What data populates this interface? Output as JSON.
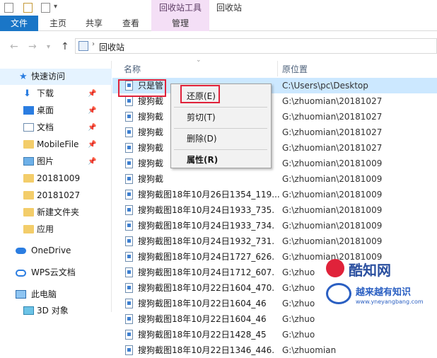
{
  "window": {
    "title": "回收站",
    "tools_label": "回收站工具"
  },
  "ribbon": {
    "tabs": [
      "文件",
      "主页",
      "共享",
      "查看",
      "管理"
    ]
  },
  "address": {
    "path": "回收站"
  },
  "sidebar": {
    "items": [
      {
        "label": "快速访问",
        "icon": "star-icon",
        "pinned": false
      },
      {
        "label": "下载",
        "icon": "download-icon",
        "pinned": true
      },
      {
        "label": "桌面",
        "icon": "desktop-icon",
        "pinned": true
      },
      {
        "label": "文档",
        "icon": "document-icon",
        "pinned": true
      },
      {
        "label": "MobileFile",
        "icon": "folder-icon",
        "pinned": true
      },
      {
        "label": "图片",
        "icon": "pictures-icon",
        "pinned": true
      },
      {
        "label": "20181009",
        "icon": "folder-icon",
        "pinned": false
      },
      {
        "label": "20181027",
        "icon": "folder-icon",
        "pinned": false
      },
      {
        "label": "新建文件夹",
        "icon": "folder-icon",
        "pinned": false
      },
      {
        "label": "应用",
        "icon": "folder-icon",
        "pinned": false
      },
      {
        "label": "OneDrive",
        "icon": "cloud-icon",
        "pinned": false
      },
      {
        "label": "WPS云文档",
        "icon": "wps-cloud-icon",
        "pinned": false
      },
      {
        "label": "此电脑",
        "icon": "computer-icon",
        "pinned": false
      },
      {
        "label": "3D 对象",
        "icon": "3d-objects-icon",
        "pinned": false
      }
    ]
  },
  "list": {
    "columns": [
      "名称",
      "原位置"
    ],
    "rows": [
      {
        "name": "只是管",
        "path": "C:\\Users\\pc\\Desktop",
        "selected": true
      },
      {
        "name": "搜狗截",
        "path": "G:\\zhuomian\\20181027"
      },
      {
        "name": "搜狗截",
        "path": "G:\\zhuomian\\20181027"
      },
      {
        "name": "搜狗截",
        "path": "G:\\zhuomian\\20181027"
      },
      {
        "name": "搜狗截",
        "path": "G:\\zhuomian\\20181027"
      },
      {
        "name": "搜狗截",
        "path": "G:\\zhuomian\\20181009"
      },
      {
        "name": "搜狗截",
        "path": "G:\\zhuomian\\20181009"
      },
      {
        "name": "搜狗截图18年10月26日1354_119...",
        "path": "G:\\zhuomian\\20181009"
      },
      {
        "name": "搜狗截图18年10月24日1933_735.",
        "path": "G:\\zhuomian\\20181009"
      },
      {
        "name": "搜狗截图18年10月24日1933_734.",
        "path": "G:\\zhuomian\\20181009"
      },
      {
        "name": "搜狗截图18年10月24日1932_731.",
        "path": "G:\\zhuomian\\20181009"
      },
      {
        "name": "搜狗截图18年10月24日1727_626.",
        "path": "G:\\zhuomian\\20181009"
      },
      {
        "name": "搜狗截图18年10月24日1712_607.",
        "path": "G:\\zhuo"
      },
      {
        "name": "搜狗截图18年10月22日1604_470.",
        "path": "G:\\zhuo"
      },
      {
        "name": "搜狗截图18年10月22日1604_46",
        "path": "G:\\zhuo"
      },
      {
        "name": "搜狗截图18年10月22日1604_46",
        "path": "G:\\zhuo"
      },
      {
        "name": "搜狗截图18年10月22日1428_45",
        "path": "G:\\zhuo"
      },
      {
        "name": "搜狗截图18年10月22日1346_446.",
        "path": "G:\\zhuomian"
      }
    ]
  },
  "context_menu": {
    "items": [
      "还原(E)",
      "剪切(T)",
      "删除(D)",
      "属性(R)"
    ]
  },
  "watermark": {
    "brand": "酷知网",
    "slogan": "越来越有知识",
    "url": "www.yneyangbang.com"
  },
  "colors": {
    "accent": "#1a76c7",
    "highlight_red": "#e0223a",
    "tools_tab": "#f4dff6",
    "selected_row": "#cce8ff"
  }
}
